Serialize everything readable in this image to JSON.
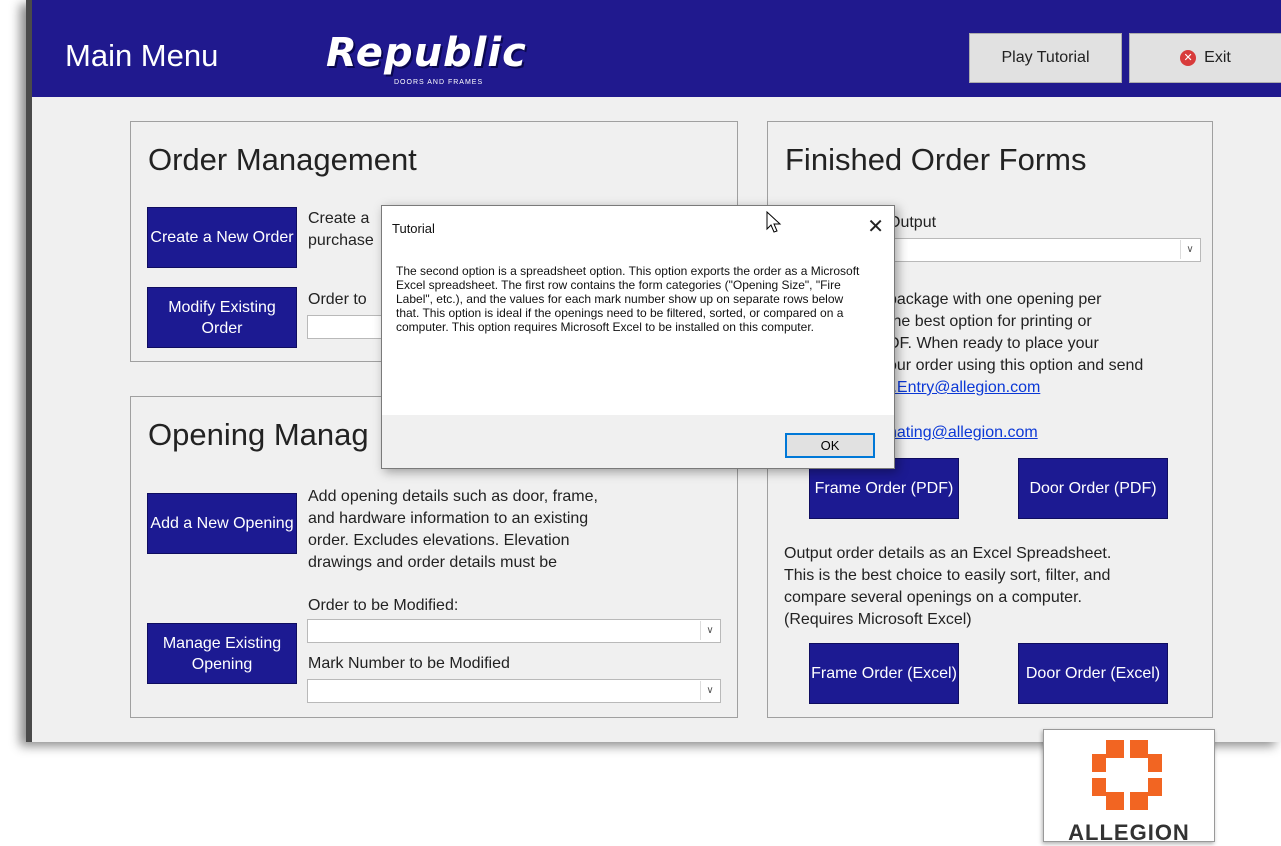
{
  "header": {
    "title": "Main Menu",
    "logo_text": "Republic",
    "logo_subtext": "DOORS AND FRAMES",
    "play_tutorial_label": "Play Tutorial",
    "exit_label": "Exit"
  },
  "order_management": {
    "title": "Order Management",
    "create_button": "Create a New Order",
    "create_desc_line1": "Create a",
    "create_desc_line2": "purchase",
    "modify_button": "Modify Existing Order",
    "order_to_label": "Order to"
  },
  "opening_management": {
    "title": "Opening Manag",
    "add_button": "Add a New Opening",
    "add_desc": [
      "Add opening details such as door, frame,",
      "and hardware information to an existing",
      "order.  Excludes elevations.  Elevation",
      "drawings and order details must be"
    ],
    "order_to_modify_label": "Order to be Modified:",
    "manage_button": "Manage Existing Opening",
    "mark_number_label": "Mark Number to be Modified"
  },
  "finished_orders": {
    "title": "Finished Order Forms",
    "output_label": "Output",
    "pdf_desc": [
      "package with one opening per",
      "the best option for printing or",
      "DF.  When ready to place your",
      "our order using this option and send"
    ],
    "email_link_partial": "r.Entry@allegion.com",
    "email2_link_partial": "nating@allegion.com",
    "frame_pdf_button": "Frame Order (PDF)",
    "door_pdf_button": "Door Order (PDF)",
    "excel_desc": [
      "Output order details as an Excel Spreadsheet.",
      "This is the best choice to easily sort, filter, and",
      "compare several openings on a computer.",
      "(Requires Microsoft Excel)"
    ],
    "frame_excel_button": "Frame Order (Excel)",
    "door_excel_button": "Door Order (Excel)"
  },
  "dialog": {
    "title": "Tutorial",
    "close_glyph": "✕",
    "body": "The second option is a spreadsheet option.  This option exports the order as a Microsoft Excel spreadsheet.  The first row contains the form categories (\"Opening Size\", \"Fire Label\", etc.), and the values for each mark number show up on separate rows below that.  This option is ideal if the openings need to be filtered, sorted, or compared on a computer.  This option requires Microsoft Excel to be installed on this computer.",
    "ok_label": "OK"
  },
  "brand": {
    "allegion_text": "ALLEGION",
    "accent": "#1c1a92",
    "header_bg": "#20198e",
    "allegion_orange": "#f26522"
  }
}
